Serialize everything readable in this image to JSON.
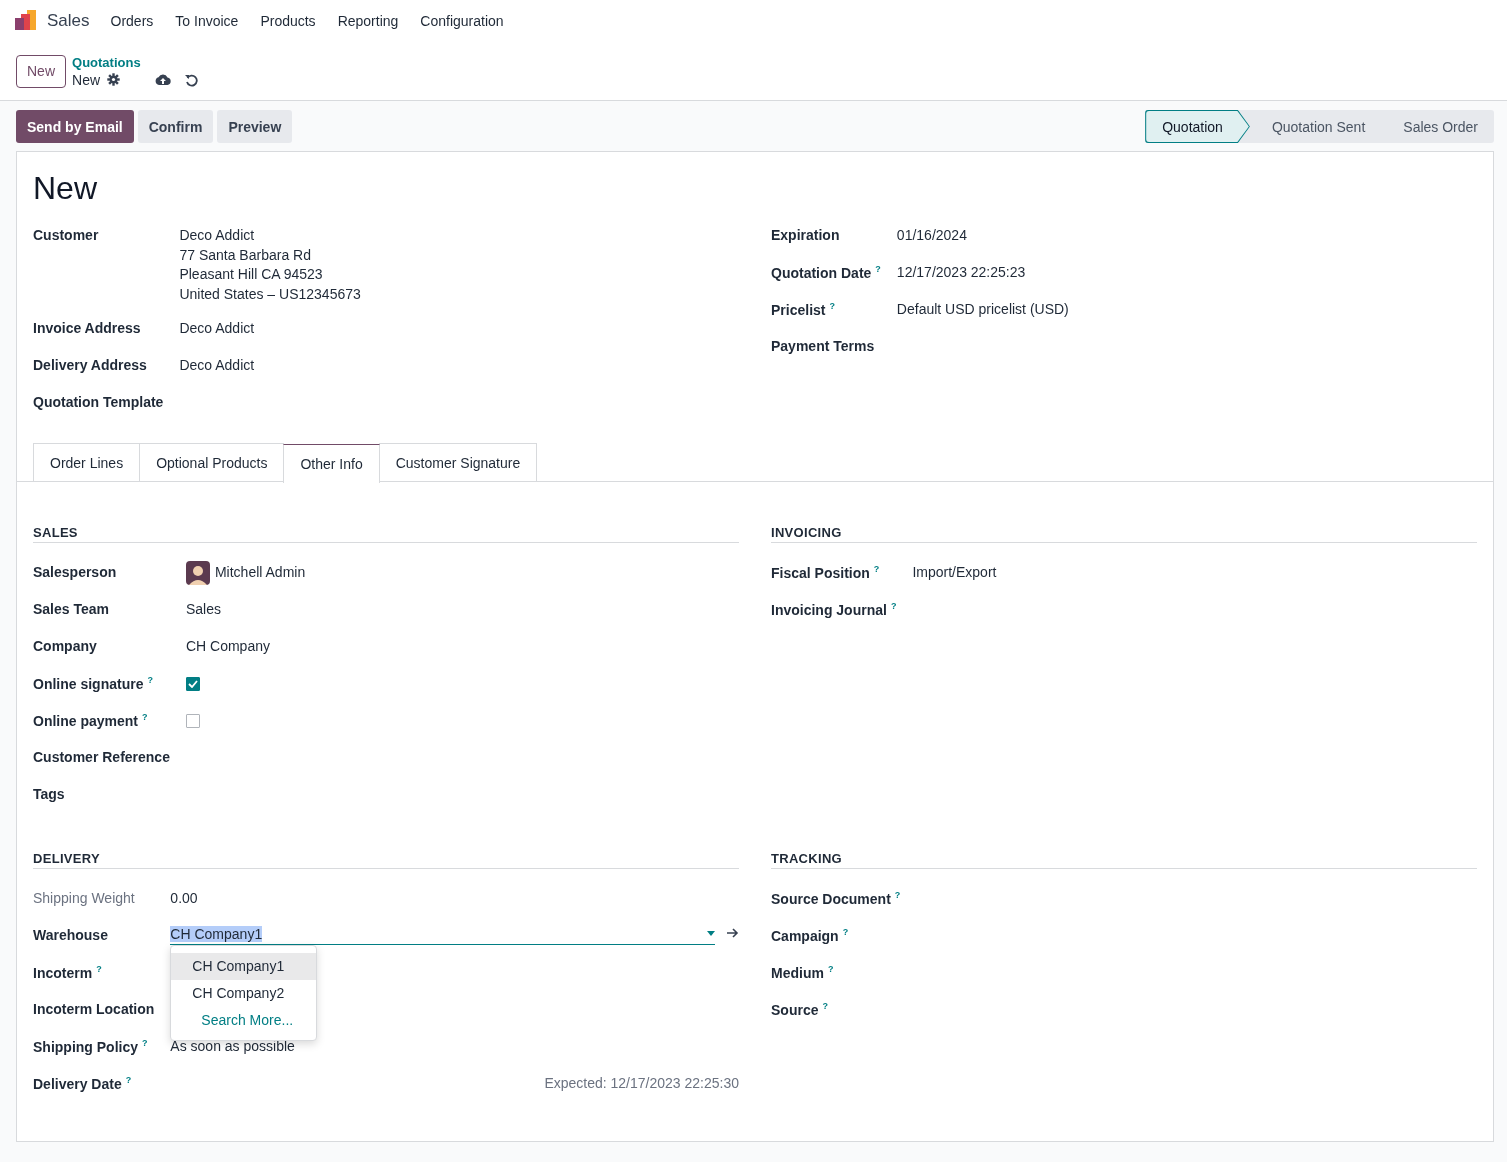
{
  "app": {
    "name": "Sales"
  },
  "menu": [
    "Orders",
    "To Invoice",
    "Products",
    "Reporting",
    "Configuration"
  ],
  "new_button": "New",
  "breadcrumb": {
    "parent": "Quotations",
    "current": "New"
  },
  "actions": [
    {
      "label": "Send by Email",
      "primary": true
    },
    {
      "label": "Confirm",
      "primary": false
    },
    {
      "label": "Preview",
      "primary": false
    }
  ],
  "stages": [
    {
      "label": "Quotation",
      "selected": true
    },
    {
      "label": "Quotation Sent",
      "selected": false
    },
    {
      "label": "Sales Order",
      "selected": false
    }
  ],
  "title": "New",
  "main_left": [
    {
      "label": "Customer",
      "kind": "lines",
      "lines": [
        "Deco Addict",
        "77 Santa Barbara Rd",
        "Pleasant Hill CA 94523",
        "United States – US12345673"
      ]
    },
    {
      "label": "Invoice Address",
      "kind": "text",
      "value": "Deco Addict"
    },
    {
      "label": "Delivery Address",
      "kind": "text",
      "value": "Deco Addict"
    },
    {
      "label": "Quotation Template",
      "kind": "text"
    }
  ],
  "main_right": [
    {
      "label": "Expiration",
      "kind": "text",
      "value": "01/16/2024"
    },
    {
      "label": "Quotation Date",
      "help": "?",
      "kind": "text",
      "value": "12/17/2023 22:25:23"
    },
    {
      "label": "Pricelist",
      "help": "?",
      "kind": "text",
      "value": "Default USD pricelist (USD)"
    },
    {
      "label": "Payment Terms",
      "kind": "text"
    }
  ],
  "tabs": [
    {
      "label": "Order Lines",
      "selected": false
    },
    {
      "label": "Optional Products",
      "selected": false
    },
    {
      "label": "Other Info",
      "selected": true
    },
    {
      "label": "Customer Signature",
      "selected": false
    }
  ],
  "sections": [
    {
      "title": "SALES",
      "fields": [
        {
          "label": "Salesperson",
          "kind": "avatar",
          "value": "Mitchell Admin"
        },
        {
          "label": "Sales Team",
          "kind": "text",
          "value": "Sales"
        },
        {
          "label": "Company",
          "kind": "text",
          "value": "CH Company"
        },
        {
          "label": "Online signature",
          "help": "?",
          "kind": "checkbox",
          "checked": true
        },
        {
          "label": "Online payment",
          "help": "?",
          "kind": "checkbox",
          "checked": false
        },
        {
          "label": "Customer Reference",
          "kind": "text"
        },
        {
          "label": "Tags",
          "kind": "text"
        }
      ]
    },
    {
      "title": "INVOICING",
      "fields": [
        {
          "label": "Fiscal Position",
          "help": "?",
          "kind": "text",
          "value": "Import/Export"
        },
        {
          "label": "Invoicing Journal",
          "help": "?",
          "kind": "text"
        }
      ]
    },
    {
      "title": "DELIVERY",
      "fields": [
        {
          "label": "Shipping Weight",
          "readonly": true,
          "kind": "text",
          "value": "0.00"
        },
        {
          "label": "Warehouse",
          "readonly": false,
          "kind": "dropdown",
          "value": "CH Company1",
          "expanded": true,
          "options": [
            {
              "label": "CH Company1",
              "selected": true
            },
            {
              "label": "CH Company2",
              "selected": false
            }
          ],
          "search_more": "Search More..."
        },
        {
          "label": "Incoterm",
          "help": "?",
          "readonly": false,
          "kind": "text"
        },
        {
          "label": "Incoterm Location",
          "readonly": false,
          "kind": "text"
        },
        {
          "label": "Shipping Policy",
          "help": "?",
          "readonly": false,
          "kind": "text",
          "value": "As soon as possible"
        },
        {
          "label": "Delivery Date",
          "help": "?",
          "readonly": false,
          "kind": "note",
          "value": "Expected: 12/17/2023 22:25:30"
        }
      ]
    },
    {
      "title": "TRACKING",
      "fields": [
        {
          "label": "Source Document",
          "help": "?",
          "kind": "text"
        },
        {
          "label": "Campaign",
          "help": "?",
          "kind": "text"
        },
        {
          "label": "Medium",
          "help": "?",
          "kind": "text"
        },
        {
          "label": "Source",
          "help": "?",
          "kind": "text"
        }
      ]
    }
  ]
}
